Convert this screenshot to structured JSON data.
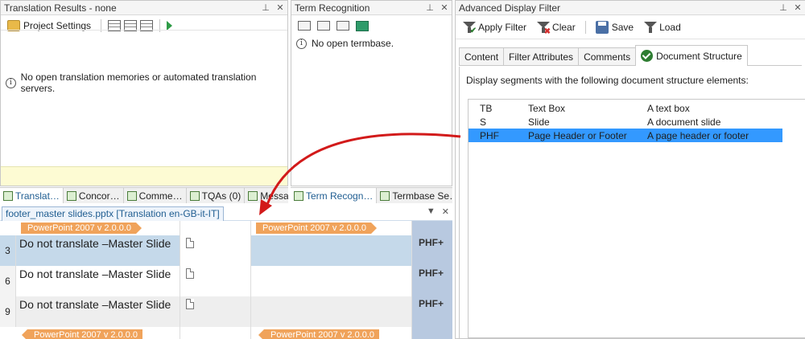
{
  "translation_results": {
    "title": "Translation Results - none",
    "pin_icon": "pin-icon",
    "close_icon": "close-icon",
    "project_settings_label": "Project Settings",
    "message": "No open translation memories or automated translation servers."
  },
  "term_recognition": {
    "title": "Term Recognition",
    "message": "No open termbase."
  },
  "left_tabs": [
    "Translat…",
    "Concor…",
    "Comme…",
    "TQAs (0)",
    "Messag…"
  ],
  "term_tabs": [
    "Term Recogn…",
    "Termbase Se…"
  ],
  "editor": {
    "doc_tab": "footer_master slides.pptx [Translation en-GB-it-IT]",
    "tag_label": "PowerPoint 2007 v 2.0.0.0",
    "rows": [
      {
        "num": "3",
        "source": "Do not translate –Master Slide",
        "style": "PHF+",
        "selected": true
      },
      {
        "num": "6",
        "source": "Do not translate –Master Slide",
        "style": "PHF+",
        "selected": false
      },
      {
        "num": "9",
        "source": "Do not translate –Master Slide",
        "style": "PHF+",
        "selected": false
      }
    ]
  },
  "advanced_filter": {
    "title": "Advanced Display Filter",
    "toolbar": {
      "apply_filter": "Apply Filter",
      "clear": "Clear",
      "save": "Save",
      "load": "Load"
    },
    "tabs": [
      "Content",
      "Filter Attributes",
      "Comments",
      "Document Structure"
    ],
    "active_tab": "Document Structure",
    "description": "Display segments with the following document structure elements:",
    "items": [
      {
        "code": "TB",
        "name": "Text Box",
        "desc": "A text box",
        "selected": false
      },
      {
        "code": "S",
        "name": "Slide",
        "desc": "A document slide",
        "selected": false
      },
      {
        "code": "PHF",
        "name": "Page Header or Footer",
        "desc": "A page header or footer",
        "selected": true
      }
    ]
  },
  "colors": {
    "selected_row": "#3399ff",
    "segment_selected": "#c5d9ea",
    "tag_orange": "#f0a35b",
    "annotation_arrow": "#d21a1a",
    "yellow_bar": "#fdfbd3"
  }
}
